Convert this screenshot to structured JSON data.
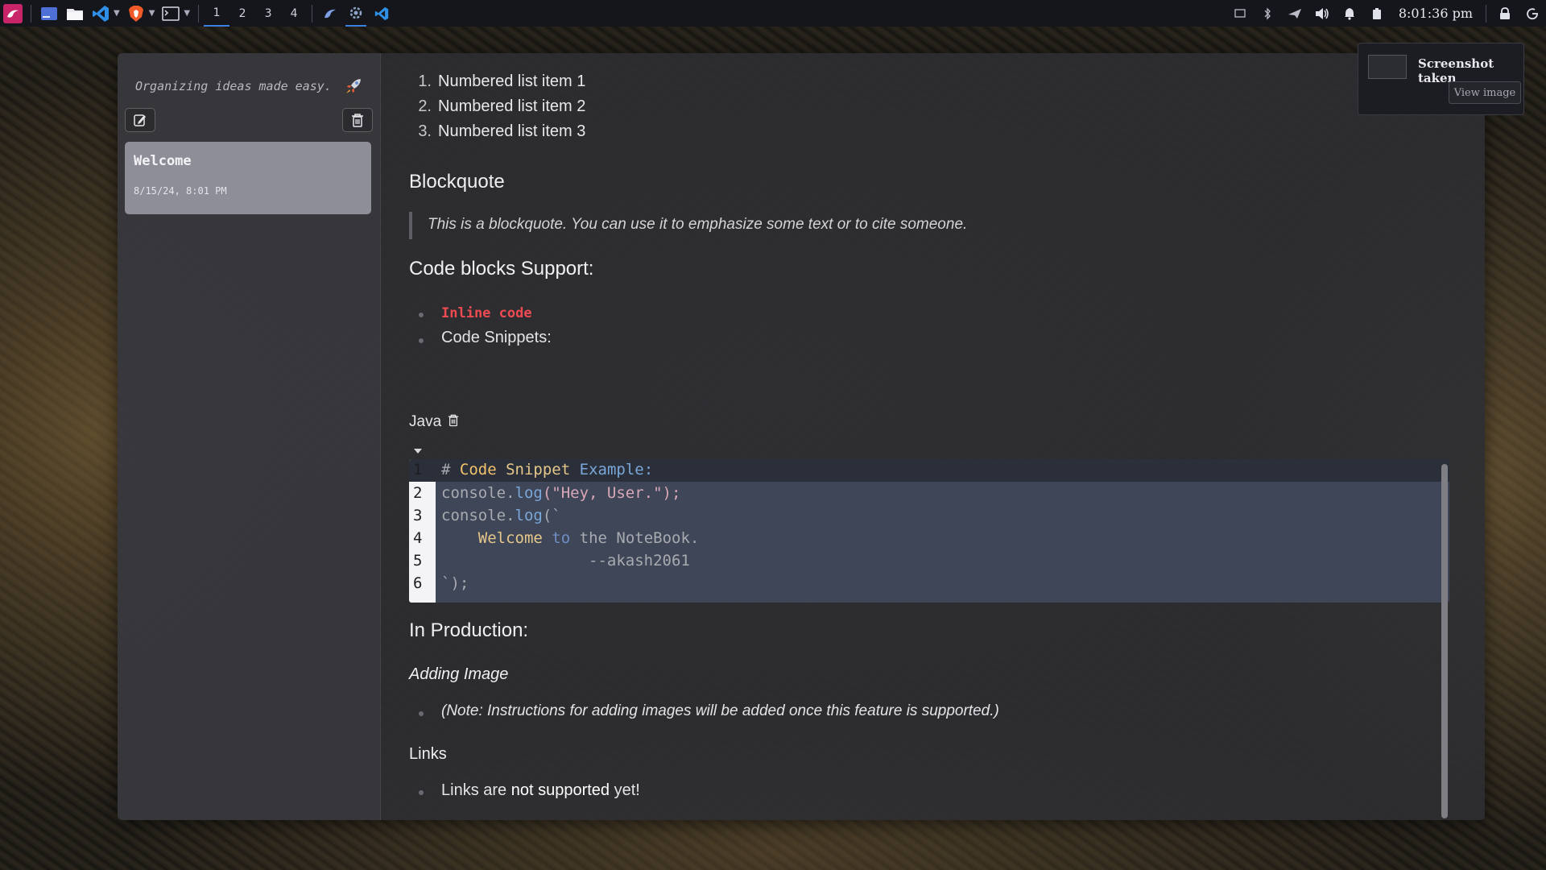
{
  "taskbar": {
    "workspaces": [
      "1",
      "2",
      "3",
      "4"
    ],
    "clock": "8:01:36 pm",
    "apps": [
      "kali-menu-icon",
      "terminal-icon",
      "file-manager-icon",
      "vscode-icon",
      "brave-icon",
      "terminal-icon"
    ],
    "tray": [
      "display-icon",
      "bluetooth-icon",
      "network-icon",
      "volume-icon",
      "bell-icon",
      "battery-icon",
      "lock-icon",
      "power-icon"
    ]
  },
  "sidebar": {
    "tagline": "Organizing ideas made easy.",
    "note": {
      "title": "Welcome",
      "date": "8/15/24, 8:01 PM"
    }
  },
  "content": {
    "ordered_list": [
      {
        "num": "1.",
        "text": "Numbered list item 1"
      },
      {
        "num": "2.",
        "text": "Numbered list item 2"
      },
      {
        "num": "3.",
        "text": "Numbered list item 3"
      }
    ],
    "blockquote_heading": "Blockquote",
    "blockquote_text": "This is a blockquote. You can use it to emphasize some text or to cite someone.",
    "code_heading": "Code blocks Support:",
    "code_items": {
      "inline": "Inline code",
      "snippets": "Code Snippets:"
    },
    "code_language": "Java",
    "code_lines": [
      {
        "n": "1",
        "hash": "# ",
        "w1": "Code",
        "w2": "Snippet",
        "w3": "Example:"
      },
      {
        "n": "2",
        "pre": "console.",
        "fn": "log",
        "args": "(\"Hey, User.\");"
      },
      {
        "n": "3",
        "pre": "console.",
        "fn": "log",
        "args": "(`"
      },
      {
        "n": "4",
        "indent": "    ",
        "w1": "Welcome",
        "w2": "to",
        "w3": "the NoteBook."
      },
      {
        "n": "5",
        "text": "                --akash2061"
      },
      {
        "n": "6",
        "text": "`);"
      }
    ],
    "production_heading": "In Production:",
    "adding_image_heading": "Adding Image",
    "adding_image_note": "(Note: Instructions for adding images will be added once this feature is supported.)",
    "links_heading": "Links",
    "links_text_before": "Links are ",
    "links_text_strong": "not supported",
    "links_text_after": " yet!"
  },
  "notification": {
    "title": "Screenshot taken",
    "button": "View image"
  },
  "colors": {
    "accent": "#3b7fe0",
    "inline_code": "#ee4a52",
    "code_bg": "#3e4658",
    "note_card": "#8e8e98"
  }
}
